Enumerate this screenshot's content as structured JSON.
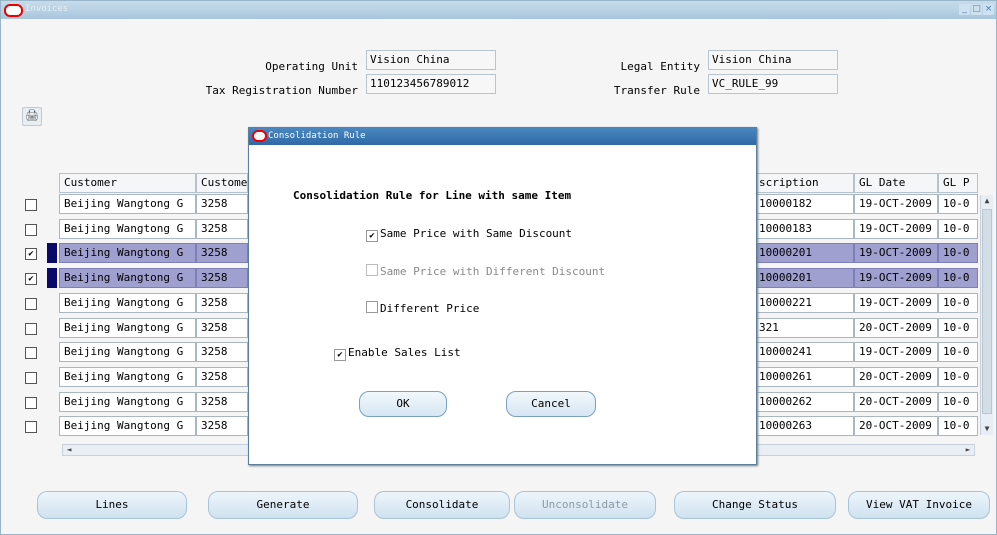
{
  "window": {
    "title": "Invoices",
    "controls": [
      "minimize",
      "maximize",
      "close"
    ]
  },
  "header": {
    "operating_unit_label": "Operating Unit",
    "operating_unit_value": "Vision China",
    "tax_reg_label": "Tax Registration Number",
    "tax_reg_value": "110123456789012",
    "legal_entity_label": "Legal Entity",
    "legal_entity_value": "Vision China",
    "transfer_rule_label": "Transfer Rule",
    "transfer_rule_value": "VC_RULE_99"
  },
  "table": {
    "columns": [
      "Customer",
      "Custome",
      "scription",
      "GL Date",
      "GL P"
    ],
    "rows": [
      {
        "checked": false,
        "selected": false,
        "customer": "Beijing Wangtong G",
        "num": "3258",
        "desc": "10000182",
        "gl_date": "19-OCT-2009",
        "glp": "10-0"
      },
      {
        "checked": false,
        "selected": false,
        "customer": "Beijing Wangtong G",
        "num": "3258",
        "desc": "10000183",
        "gl_date": "19-OCT-2009",
        "glp": "10-0"
      },
      {
        "checked": true,
        "selected": true,
        "customer": "Beijing Wangtong G",
        "num": "3258",
        "desc": "10000201",
        "gl_date": "19-OCT-2009",
        "glp": "10-0"
      },
      {
        "checked": true,
        "selected": true,
        "customer": "Beijing Wangtong G",
        "num": "3258",
        "desc": "10000201",
        "gl_date": "19-OCT-2009",
        "glp": "10-0"
      },
      {
        "checked": false,
        "selected": false,
        "customer": "Beijing Wangtong G",
        "num": "3258",
        "desc": "10000221",
        "gl_date": "19-OCT-2009",
        "glp": "10-0"
      },
      {
        "checked": false,
        "selected": false,
        "customer": "Beijing Wangtong G",
        "num": "3258",
        "desc": "321",
        "gl_date": "20-OCT-2009",
        "glp": "10-0"
      },
      {
        "checked": false,
        "selected": false,
        "customer": "Beijing Wangtong G",
        "num": "3258",
        "desc": "10000241",
        "gl_date": "19-OCT-2009",
        "glp": "10-0"
      },
      {
        "checked": false,
        "selected": false,
        "customer": "Beijing Wangtong G",
        "num": "3258",
        "desc": "10000261",
        "gl_date": "20-OCT-2009",
        "glp": "10-0"
      },
      {
        "checked": false,
        "selected": false,
        "customer": "Beijing Wangtong G",
        "num": "3258",
        "desc": "10000262",
        "gl_date": "20-OCT-2009",
        "glp": "10-0"
      },
      {
        "checked": false,
        "selected": false,
        "customer": "Beijing Wangtong G",
        "num": "3258",
        "desc": "10000263",
        "gl_date": "20-OCT-2009",
        "glp": "10-0"
      }
    ]
  },
  "buttons": {
    "lines": "Lines",
    "generate": "Generate",
    "consolidate": "Consolidate",
    "unconsolidate": "Unconsolidate",
    "change_status": "Change Status",
    "view_vat_invoice": "View VAT Invoice"
  },
  "dialog": {
    "title": "Consolidation Rule",
    "heading": "Consolidation Rule for Line with same Item",
    "options": [
      {
        "label": "Same Price with Same Discount",
        "checked": true,
        "enabled": true
      },
      {
        "label": "Same Price with Different Discount",
        "checked": false,
        "enabled": false
      },
      {
        "label": "Different Price",
        "checked": false,
        "enabled": true
      }
    ],
    "enable_sales_list": {
      "label": "Enable Sales List",
      "checked": true
    },
    "ok_label": "OK",
    "cancel_label": "Cancel"
  },
  "colors": {
    "selected_row": "#9f9fd0",
    "dialog_titlebar": "#2f6aa6",
    "window_titlebar": "#a9c6dc",
    "button_fill": "#cfe2f0"
  }
}
